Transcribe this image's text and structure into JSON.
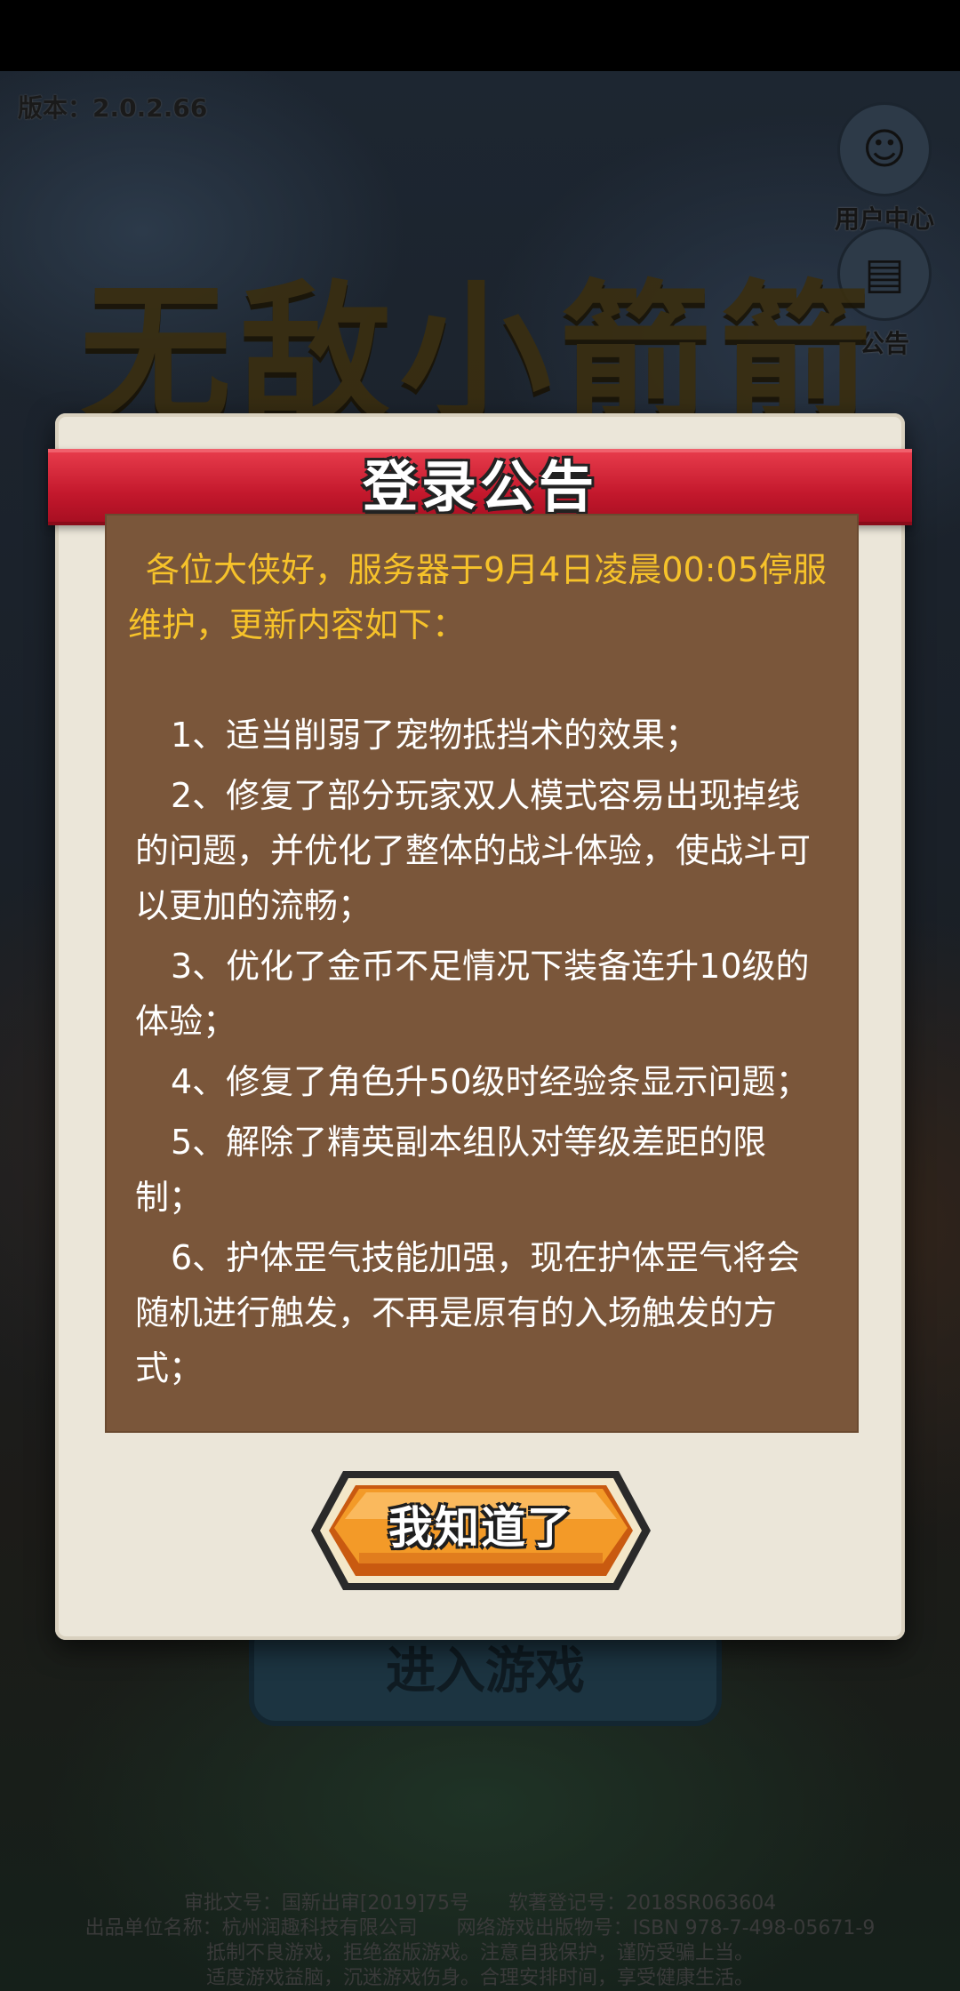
{
  "version": {
    "label": "版本：2.0.2.66"
  },
  "side_buttons": {
    "user_center": "用户中心",
    "announcement": "公告"
  },
  "background": {
    "game_title": "无敌小箭箭",
    "enter_game": "进入游戏"
  },
  "dialog": {
    "title": "登录公告",
    "intro": "各位大侠好，服务器于9月4日凌晨00:05停服维护，更新内容如下：",
    "items": [
      "1、适当削弱了宠物抵挡术的效果；",
      "2、修复了部分玩家双人模式容易出现掉线的问题，并优化了整体的战斗体验，使战斗可以更加的流畅；",
      "3、优化了金币不足情况下装备连升10级的体验；",
      "4、修复了角色升50级时经验条显示问题；",
      "5、解除了精英副本组队对等级差距的限制；",
      "6、护体罡气技能加强，现在护体罡气将会随机进行触发，不再是原有的入场触发的方式；"
    ],
    "ok_button": "我知道了"
  },
  "footer": {
    "line1": "审批文号：国新出审[2019]75号　　软著登记号：2018SR063604",
    "line2": "出品单位名称：杭州润趣科技有限公司　　网络游戏出版物号：ISBN 978-7-498-05671-9",
    "line3": "抵制不良游戏，拒绝盗版游戏。注意自我保护，谨防受骗上当。",
    "line4": "适度游戏益脑，沉迷游戏伤身。合理安排时间，享受健康生活。"
  },
  "colors": {
    "ribbon_red": "#c3182c",
    "panel_brown": "#7a563a",
    "intro_yellow": "#f6c22a",
    "button_orange": "#f08a1c"
  }
}
